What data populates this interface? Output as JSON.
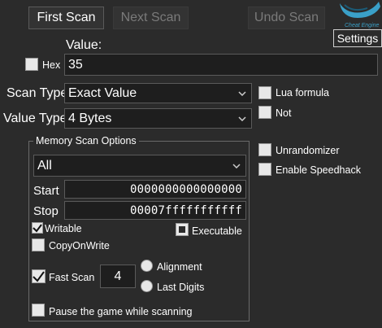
{
  "buttons": {
    "first_scan": "First Scan",
    "next_scan": "Next Scan",
    "undo_scan": "Undo Scan",
    "settings": "Settings"
  },
  "logo": {
    "text": "Cheat Engine",
    "icon": "cheat-engine-logo"
  },
  "value": {
    "label": "Value:",
    "hex_label": "Hex",
    "hex_checked": false,
    "input": "35"
  },
  "scan_type": {
    "label": "Scan Type",
    "selected": "Exact Value"
  },
  "value_type": {
    "label": "Value Type",
    "selected": "4 Bytes"
  },
  "right_options": {
    "lua_formula": "Lua formula",
    "not": "Not",
    "unrandomizer": "Unrandomizer",
    "enable_speedhack": "Enable Speedhack"
  },
  "memory": {
    "title": "Memory Scan Options",
    "region": "All",
    "start_label": "Start",
    "start_value": "0000000000000000",
    "stop_label": "Stop",
    "stop_value": "00007fffffffffff",
    "writable": "Writable",
    "writable_checked": true,
    "executable": "Executable",
    "copy_on_write": "CopyOnWrite",
    "fast_scan": "Fast Scan",
    "fast_scan_checked": true,
    "fast_scan_value": "4",
    "alignment": "Alignment",
    "last_digits": "Last Digits",
    "pause": "Pause the game while scanning"
  },
  "colors": {
    "background": "#2b2b2b",
    "field": "#1e1e1e",
    "logo": "#3aa0c8"
  }
}
